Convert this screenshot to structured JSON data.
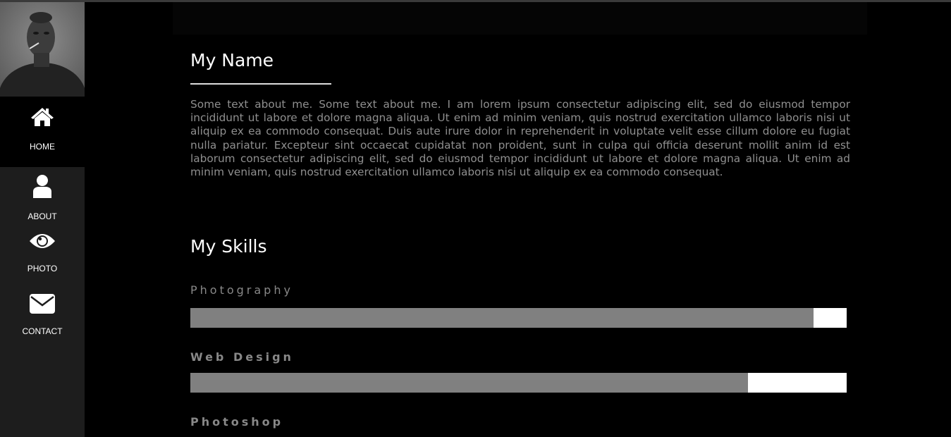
{
  "nav": {
    "items": [
      {
        "label": "HOME",
        "icon": "home-icon",
        "active": true
      },
      {
        "label": "ABOUT",
        "icon": "user-icon",
        "active": false
      },
      {
        "label": "PHOTO",
        "icon": "eye-icon",
        "active": false
      },
      {
        "label": "CONTACT",
        "icon": "envelope-icon",
        "active": false
      }
    ]
  },
  "about": {
    "title": "My Name",
    "text": "Some text about me. Some text about me. I am lorem ipsum consectetur adipiscing elit, sed do eiusmod tempor incididunt ut labore et dolore magna aliqua. Ut enim ad minim veniam, quis nostrud exercitation ullamco laboris nisi ut aliquip ex ea commodo consequat. Duis aute irure dolor in reprehenderit in voluptate velit esse cillum dolore eu fugiat nulla pariatur. Excepteur sint occaecat cupidatat non proident, sunt in culpa qui officia deserunt mollit anim id est laborum consectetur adipiscing elit, sed do eiusmod tempor incididunt ut labore et dolore magna aliqua. Ut enim ad minim veniam, quis nostrud exercitation ullamco laboris nisi ut aliquip ex ea commodo consequat."
  },
  "skills": {
    "title": "My Skills",
    "items": [
      {
        "label": "Photography",
        "level_percent": 95
      },
      {
        "label": "Web Design",
        "level_percent": 85
      },
      {
        "label": "Photoshop"
      }
    ]
  },
  "colors": {
    "background": "#000000",
    "sidebar": "#1d1d1d",
    "bar_fill": "#808080",
    "bar_track": "#ffffff",
    "text_muted": "#8f8f8f"
  }
}
